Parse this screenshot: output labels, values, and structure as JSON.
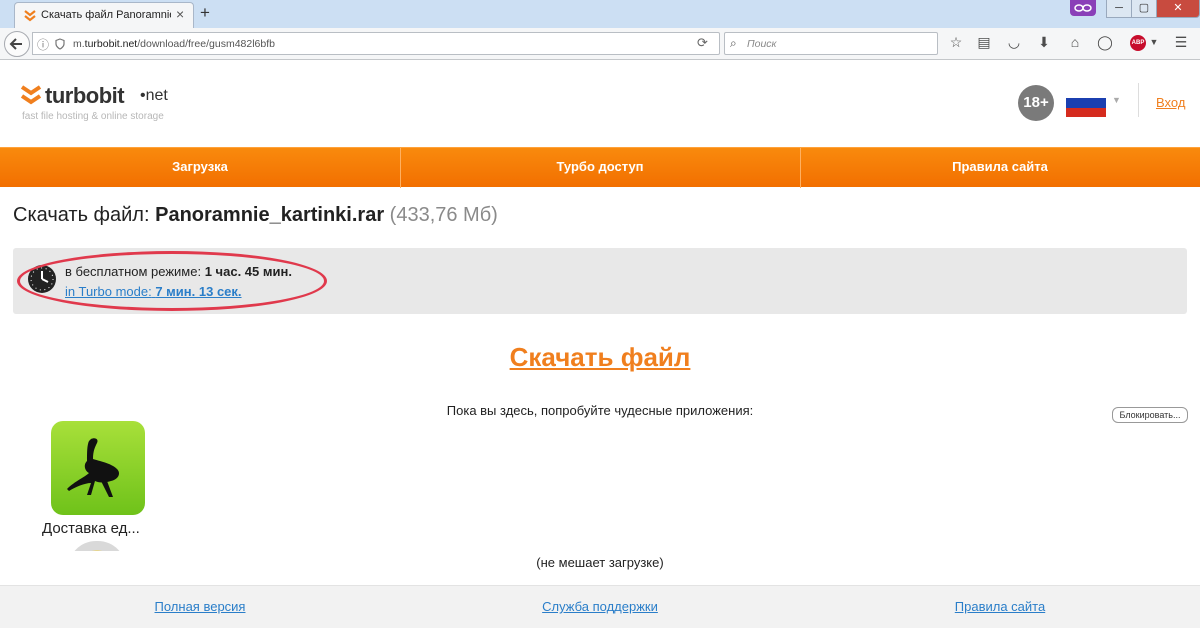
{
  "browser": {
    "tab_title": "Скачать файл Panoramnie...",
    "tab_close": "×",
    "new_tab": "+",
    "url_info": "ⓘ",
    "url_prefix": "m.",
    "url_host": "turbobit.net",
    "url_path": "/download/free/gusm482l6bfb",
    "search_placeholder": "Поиск",
    "abp_label": "ABP",
    "window_controls": [
      "─",
      "▢",
      "✕"
    ]
  },
  "site": {
    "logo_main": "turbobit",
    "logo_suffix": "•net",
    "tagline": "fast file hosting & online storage",
    "age_badge": "18+",
    "login": "Вход",
    "flag_colors": [
      "#ffffff",
      "#1b3fb0",
      "#d52b1e"
    ],
    "accent_color": "#f07f1e"
  },
  "nav": {
    "items": [
      "Загрузка",
      "Турбо доступ",
      "Правила сайта"
    ]
  },
  "file": {
    "prefix": "Скачать файл:",
    "name": "Panoramnie_kartinki.rar",
    "size": "(433,76 Мб)"
  },
  "wait": {
    "free_label": "в бесплатном режиме:",
    "free_time": "1 час. 45 мин.",
    "turbo_label": "in Turbo mode:",
    "turbo_time": "7 мин. 13 сек."
  },
  "download_button": "Скачать файл",
  "promo": {
    "text": "Пока вы здесь, попробуйте чудесные приложения:",
    "block_button": "Блокировать...",
    "app_label": "Доставка ед...",
    "note": "(не мешает загрузке)"
  },
  "footer": {
    "links": [
      "Полная версия",
      "Служба поддержки",
      "Правила сайта"
    ]
  }
}
